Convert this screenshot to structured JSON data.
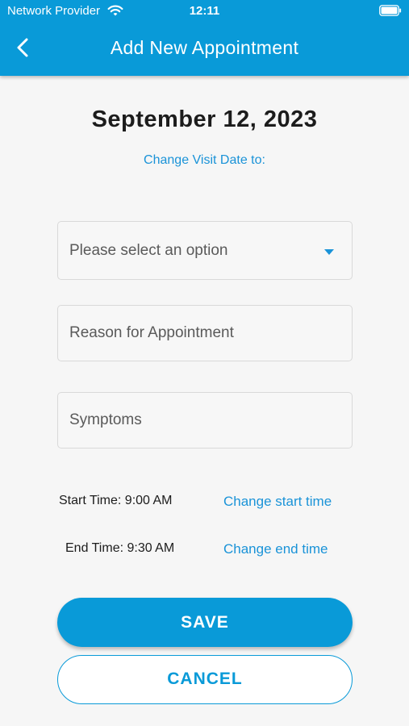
{
  "status_bar": {
    "carrier": "Network Provider",
    "time": "12:11"
  },
  "app_bar": {
    "title": "Add New Appointment"
  },
  "visit": {
    "date": "September 12, 2023",
    "change_date_label": "Change Visit Date to:"
  },
  "form": {
    "select_placeholder": "Please select an option",
    "reason_placeholder": "Reason for Appointment",
    "symptoms_placeholder": "Symptoms"
  },
  "times": {
    "start_label": "Start Time: 9:00 AM",
    "start_link": "Change start time",
    "end_label": "End Time: 9:30 AM",
    "end_link": "Change end time"
  },
  "actions": {
    "save_label": "SAVE",
    "cancel_label": "CANCEL"
  },
  "colors": {
    "primary": "#099ad8",
    "link": "#1a93d8",
    "background": "#f6f6f6"
  },
  "icons": {
    "back": "chevron-left-icon",
    "wifi": "wifi-icon",
    "battery": "battery-icon",
    "dropdown": "caret-down-icon"
  }
}
